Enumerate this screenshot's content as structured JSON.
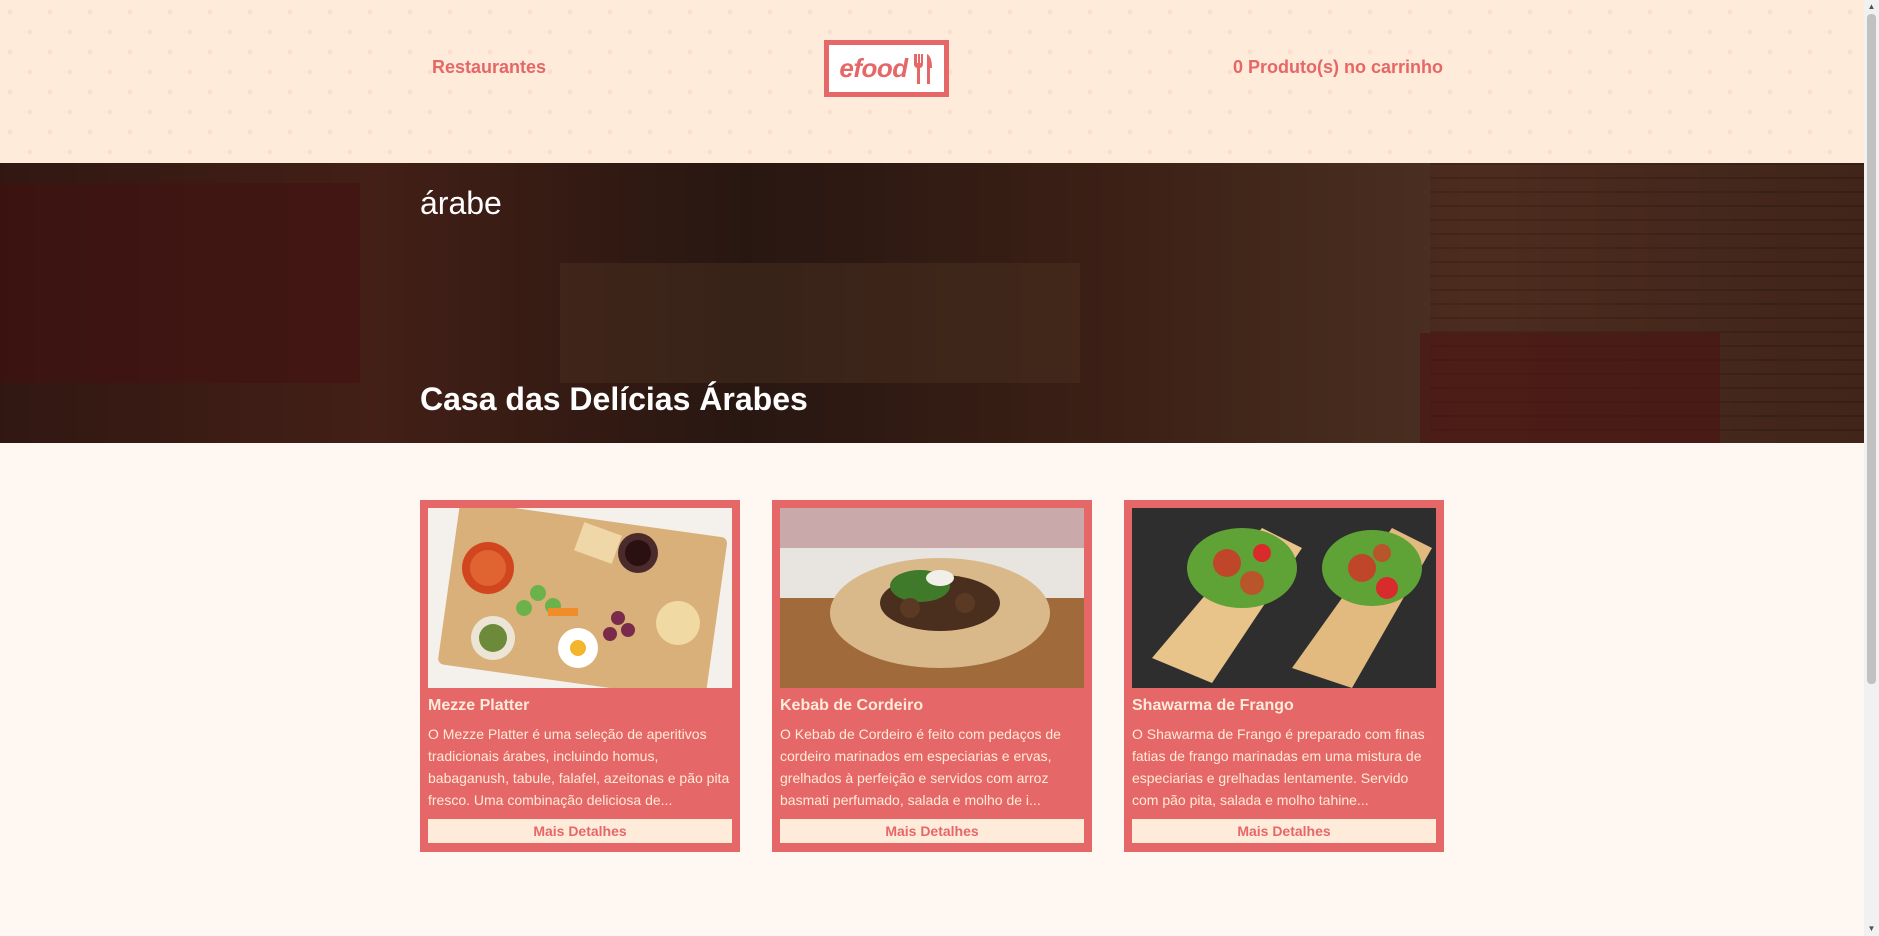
{
  "header": {
    "restaurants_label": "Restaurantes",
    "logo_text": "efood",
    "cart_label": "0 Produto(s) no carrinho"
  },
  "banner": {
    "category": "árabe",
    "title": "Casa das Delícias Árabes"
  },
  "products": [
    {
      "name": "Mezze Platter",
      "description": "O Mezze Platter é uma seleção de aperitivos tradicionais árabes, incluindo homus, babaganush, tabule, falafel, azeitonas e pão pita fresco. Uma combinação deliciosa de...",
      "button_label": "Mais Detalhes"
    },
    {
      "name": "Kebab de Cordeiro",
      "description": "O Kebab de Cordeiro é feito com pedaços de cordeiro marinados em especiarias e ervas, grelhados à perfeição e servidos com arroz basmati perfumado, salada e molho de i...",
      "button_label": "Mais Detalhes"
    },
    {
      "name": "Shawarma de Frango",
      "description": "O Shawarma de Frango é preparado com finas fatias de frango marinadas em uma mistura de especiarias e grelhadas lentamente. Servido com pão pita, salada e molho tahine...",
      "button_label": "Mais Detalhes"
    }
  ],
  "colors": {
    "accent": "#e66767",
    "header_bg": "#ffebd9",
    "page_bg": "#fff8f2"
  }
}
